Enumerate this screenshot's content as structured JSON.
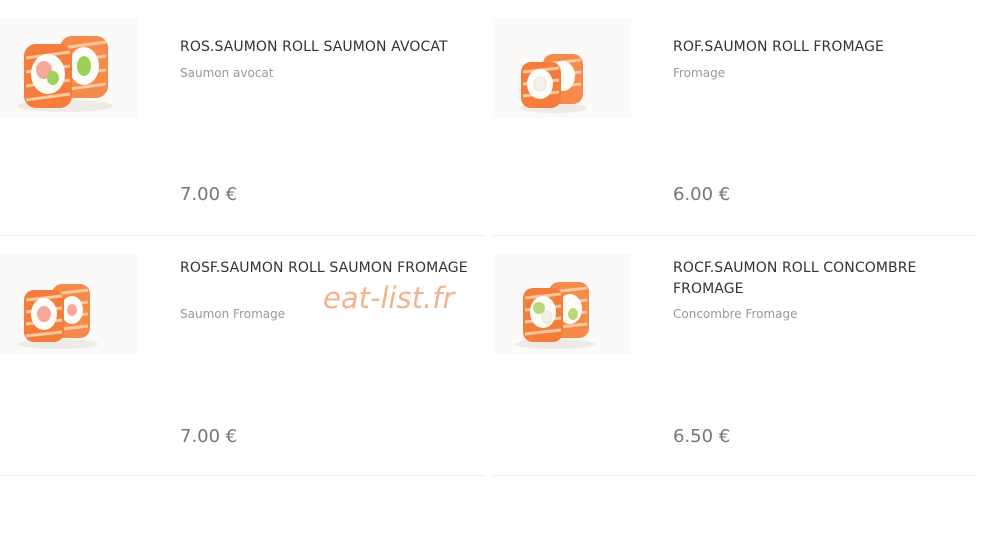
{
  "products": [
    {
      "title": "ROS.SAUMON ROLL SAUMON AVOCAT",
      "description": "Saumon avocat",
      "price": "7.00 €",
      "image_icon": "sushi-roll-salmon-avocado-image",
      "filling_color": "#9bd35a"
    },
    {
      "title": "ROF.SAUMON ROLL FROMAGE",
      "description": "Fromage",
      "price": "6.00 €",
      "image_icon": "sushi-roll-salmon-cheese-image",
      "filling_color": "#f4f1ea"
    },
    {
      "title": "ROSF.SAUMON ROLL SAUMON FROMAGE",
      "description": "Saumon Fromage",
      "price": "7.00 €",
      "image_icon": "sushi-roll-salmon-salmon-cheese-image",
      "filling_color": "#f6a89a"
    },
    {
      "title": "ROCF.SAUMON ROLL CONCOMBRE FROMAGE",
      "description": "Concombre Fromage",
      "price": "6.50 €",
      "image_icon": "sushi-roll-salmon-cucumber-cheese-image",
      "filling_color": "#b8d87a"
    }
  ],
  "watermark": "eat-list.fr",
  "colors": {
    "salmon": "#f58a4a",
    "salmon_stripe": "#fbc8a0",
    "rice": "#fffdf7",
    "price_text": "#777777",
    "title_text": "#333333",
    "desc_text": "#999999"
  }
}
